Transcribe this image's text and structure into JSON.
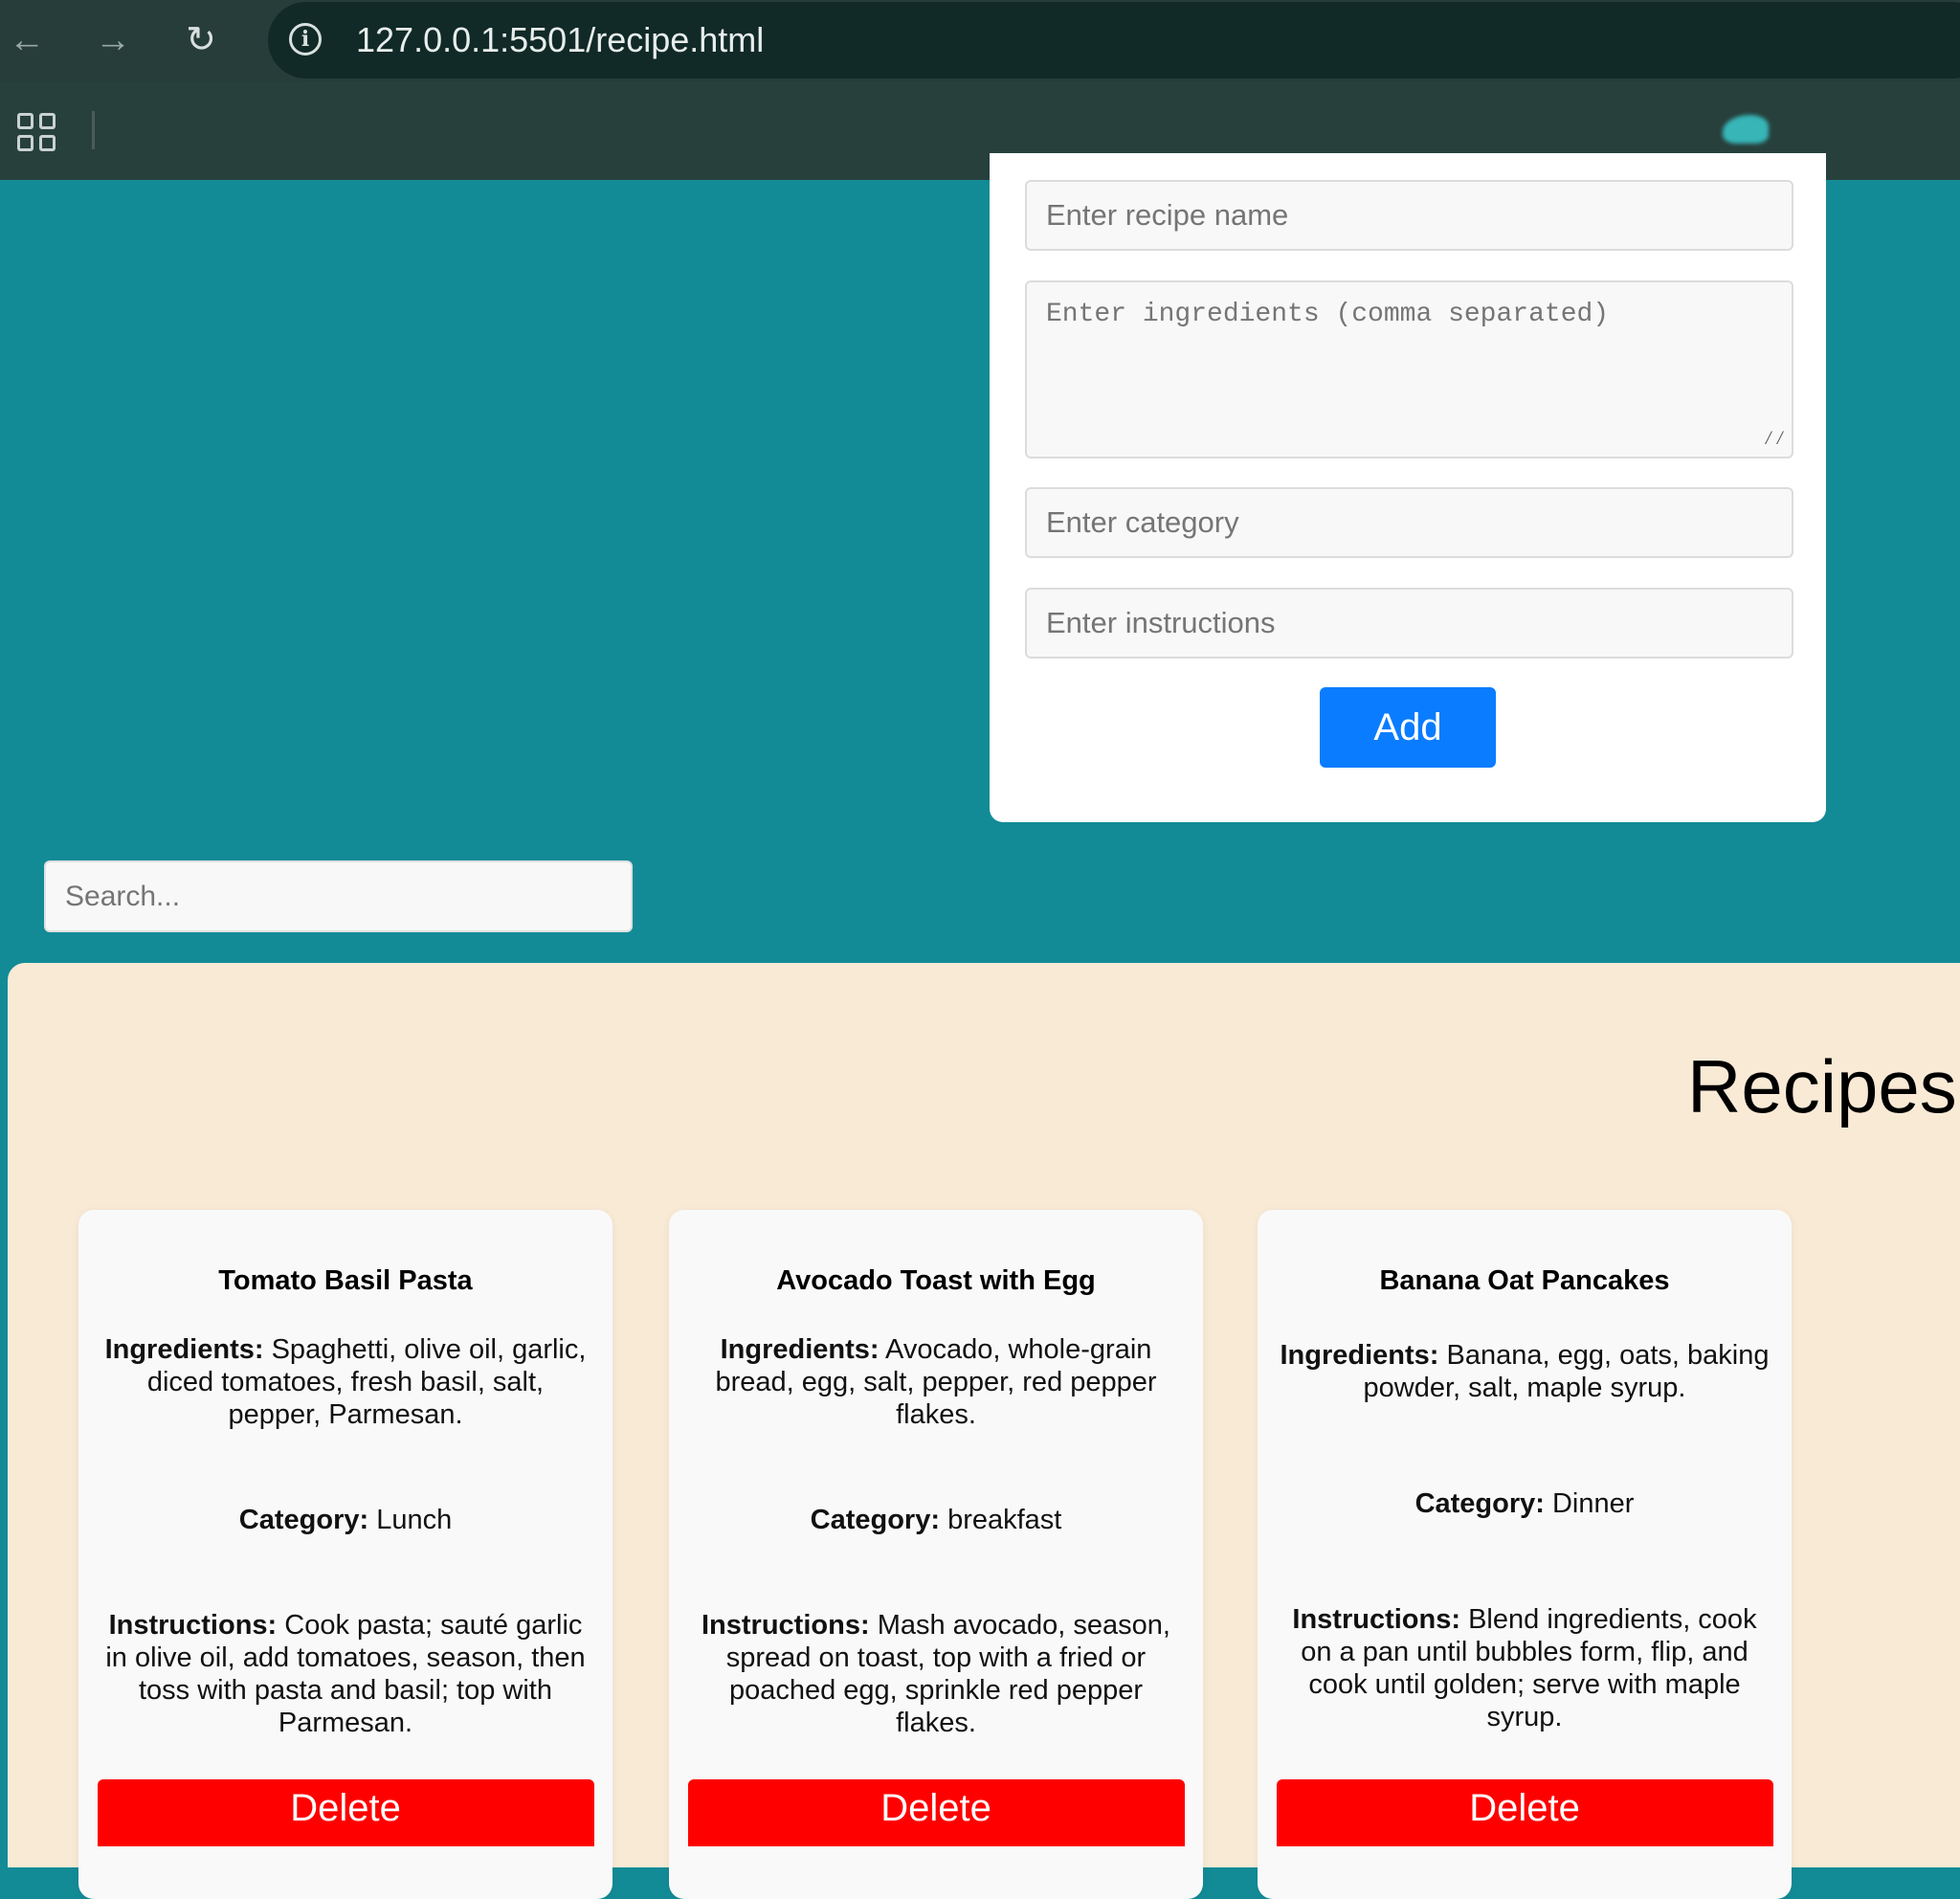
{
  "browser": {
    "url": "127.0.0.1:5501/recipe.html"
  },
  "form": {
    "name_placeholder": "Enter recipe name",
    "ingredients_placeholder": "Enter ingredients (comma separated)",
    "category_placeholder": "Enter category",
    "instructions_placeholder": "Enter instructions",
    "add_label": "Add"
  },
  "search": {
    "placeholder": "Search..."
  },
  "recipes": {
    "heading": "Recipes",
    "labels": {
      "ingredients": "Ingredients:",
      "category": "Category:",
      "instructions": "Instructions:"
    },
    "delete_label": "Delete",
    "items": [
      {
        "title": "Tomato Basil Pasta",
        "ingredients": "Spaghetti, olive oil, garlic, diced tomatoes, fresh basil, salt, pepper, Parmesan.",
        "category": "Lunch",
        "instructions": "Cook pasta; sauté garlic in olive oil, add tomatoes, season, then toss with pasta and basil; top with Parmesan."
      },
      {
        "title": "Avocado Toast with Egg",
        "ingredients": "Avocado, whole-grain bread, egg, salt, pepper, red pepper flakes.",
        "category": "breakfast",
        "instructions": "Mash avocado, season, spread on toast, top with a fried or poached egg, sprinkle red pepper flakes."
      },
      {
        "title": "Banana Oat Pancakes",
        "ingredients": "Banana, egg, oats, baking powder, salt, maple syrup.",
        "category": "Dinner",
        "instructions": "Blend ingredients, cook on a pan until bubbles form, flip, and cook until golden; serve with maple syrup."
      }
    ]
  },
  "colors": {
    "page_bg": "#138b97",
    "section_bg": "#f9ead6",
    "add_button": "#0a7cff",
    "delete_button": "#ff0000"
  }
}
